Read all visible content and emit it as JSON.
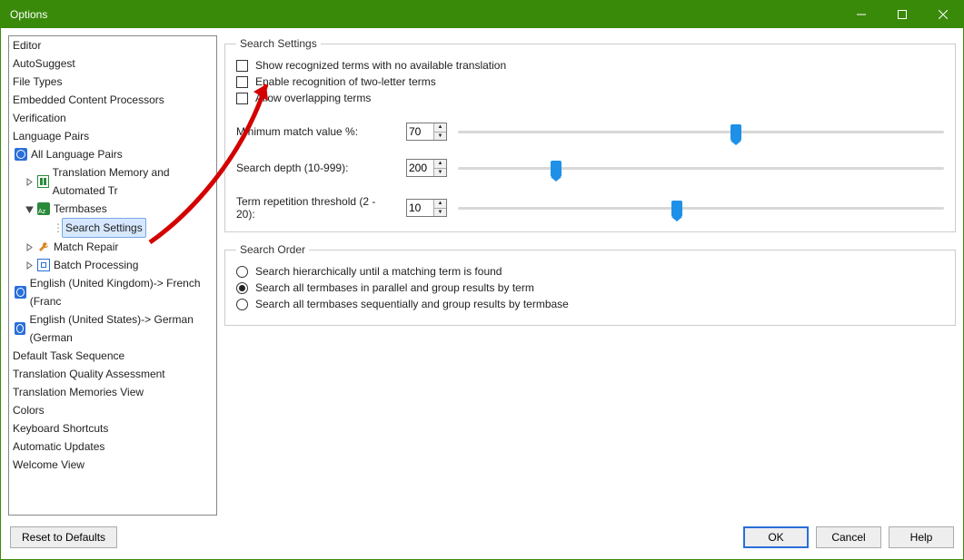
{
  "window": {
    "title": "Options"
  },
  "sidebar": {
    "items": [
      "Editor",
      "AutoSuggest",
      "File Types",
      "Embedded Content Processors",
      "Verification",
      "Language Pairs"
    ],
    "lp_root": "All Language Pairs",
    "lp_children": {
      "tm": "Translation Memory and Automated Tr",
      "tb": "Termbases",
      "tb_child": "Search Settings",
      "mr": "Match Repair",
      "bp": "Batch Processing"
    },
    "lang_rows": [
      "English (United Kingdom)-> French (Franc",
      "English (United States)-> German (German"
    ],
    "tail": [
      "Default Task Sequence",
      "Translation Quality Assessment",
      "Translation Memories View",
      "Colors",
      "Keyboard Shortcuts",
      "Automatic Updates",
      "Welcome View"
    ]
  },
  "search_settings": {
    "legend": "Search Settings",
    "cb1": "Show recognized terms with no available translation",
    "cb2": "Enable recognition of two-letter terms",
    "cb3": "Allow overlapping terms",
    "min_match_label": "Minimum match value %:",
    "min_match_value": "70",
    "min_match_pct": 56,
    "depth_label": "Search depth (10-999):",
    "depth_value": "200",
    "depth_pct": 19,
    "rep_label": "Term repetition threshold (2 - 20):",
    "rep_value": "10",
    "rep_pct": 44
  },
  "search_order": {
    "legend": "Search Order",
    "r1": "Search hierarchically until a matching term is found",
    "r2": "Search all termbases in parallel and group results by term",
    "r3": "Search all termbases sequentially and group results by termbase",
    "selected": 1
  },
  "footer": {
    "reset": "Reset to Defaults",
    "ok": "OK",
    "cancel": "Cancel",
    "help": "Help"
  }
}
